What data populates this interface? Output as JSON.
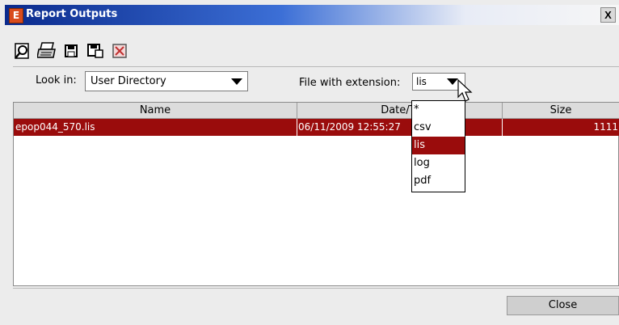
{
  "window": {
    "title": "Report Outputs",
    "close_glyph": "X",
    "app_icon_letter": "E"
  },
  "toolbar": {
    "buttons": [
      {
        "icon": "preview-icon"
      },
      {
        "icon": "print-icon"
      },
      {
        "icon": "save-icon"
      },
      {
        "icon": "save-as-icon"
      },
      {
        "icon": "delete-icon"
      }
    ]
  },
  "filters": {
    "look_in_label": "Look in:",
    "look_in_value": "User Directory",
    "extension_label": "File with extension:",
    "extension_value": "lis",
    "extension_options": [
      "*",
      "csv",
      "lis",
      "log",
      "pdf"
    ],
    "selected_option": "lis"
  },
  "table": {
    "columns": [
      "Name",
      "Date/Ti",
      "Size"
    ],
    "rows": [
      {
        "name": "epop044_570.lis",
        "date": "06/11/2009 12:55:27",
        "size": "1111"
      }
    ]
  },
  "footer": {
    "close_label": "Close"
  },
  "colors": {
    "selection": "#9a0c0c",
    "title_bar": "#0a2a8c"
  }
}
